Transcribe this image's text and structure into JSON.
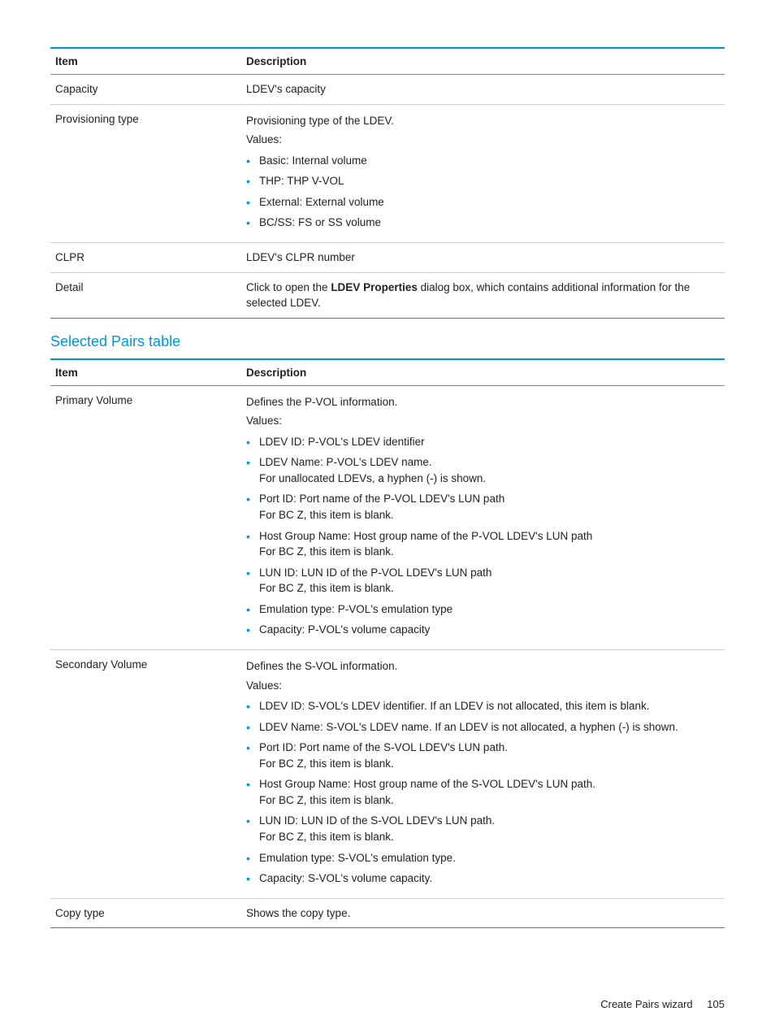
{
  "table1": {
    "head_item": "Item",
    "head_desc": "Description",
    "rows": {
      "capacity": {
        "item": "Capacity",
        "desc": "LDEV's capacity"
      },
      "provtype": {
        "item": "Provisioning type",
        "intro1": "Provisioning type of the LDEV.",
        "intro2": "Values:",
        "b0": "Basic: Internal volume",
        "b1": "THP: THP V-VOL",
        "b2": "External: External volume",
        "b3": "BC/SS: FS or SS volume"
      },
      "clpr": {
        "item": "CLPR",
        "desc": "LDEV's CLPR number"
      },
      "detail": {
        "item": "Detail",
        "d_pre": "Click to open the ",
        "d_bold": "LDEV Properties",
        "d_post": " dialog box, which contains additional information for the selected LDEV."
      }
    }
  },
  "section_title": "Selected Pairs table",
  "table2": {
    "head_item": "Item",
    "head_desc": "Description",
    "rows": {
      "pvol": {
        "item": "Primary Volume",
        "intro1": "Defines the P-VOL information.",
        "intro2": "Values:",
        "b0": "LDEV ID: P-VOL's LDEV identifier",
        "b1a": "LDEV Name: P-VOL's LDEV name.",
        "b1b": "For unallocated LDEVs, a hyphen (-) is shown.",
        "b2a": "Port ID: Port name of the P-VOL LDEV's LUN path",
        "b2b": "For BC Z, this item is blank.",
        "b3a": "Host Group Name: Host group name of the P-VOL LDEV's LUN path",
        "b3b": "For BC Z, this item is blank.",
        "b4a": "LUN ID: LUN ID of the P-VOL LDEV's LUN path",
        "b4b": "For BC Z, this item is blank.",
        "b5": "Emulation type: P-VOL's emulation type",
        "b6": "Capacity: P-VOL's volume capacity"
      },
      "svol": {
        "item": "Secondary Volume",
        "intro1": "Defines the S-VOL information.",
        "intro2": "Values:",
        "b0": "LDEV ID: S-VOL's LDEV identifier. If an LDEV is not allocated, this item is blank.",
        "b1": "LDEV Name: S-VOL's LDEV name. If an LDEV is not allocated, a hyphen (-) is shown.",
        "b2a": "Port ID: Port name of the S-VOL LDEV's LUN path.",
        "b2b": "For BC Z, this item is blank.",
        "b3a": "Host Group Name: Host group name of the S-VOL LDEV's LUN path.",
        "b3b": "For BC Z, this item is blank.",
        "b4a": "LUN ID: LUN ID of the S-VOL LDEV's LUN path.",
        "b4b": "For BC Z, this item is blank.",
        "b5": "Emulation type: S-VOL's emulation type.",
        "b6": "Capacity: S-VOL's volume capacity."
      },
      "copytype": {
        "item": "Copy type",
        "desc": "Shows the copy type."
      }
    }
  },
  "footer_text": "Create Pairs wizard",
  "footer_page": "105"
}
